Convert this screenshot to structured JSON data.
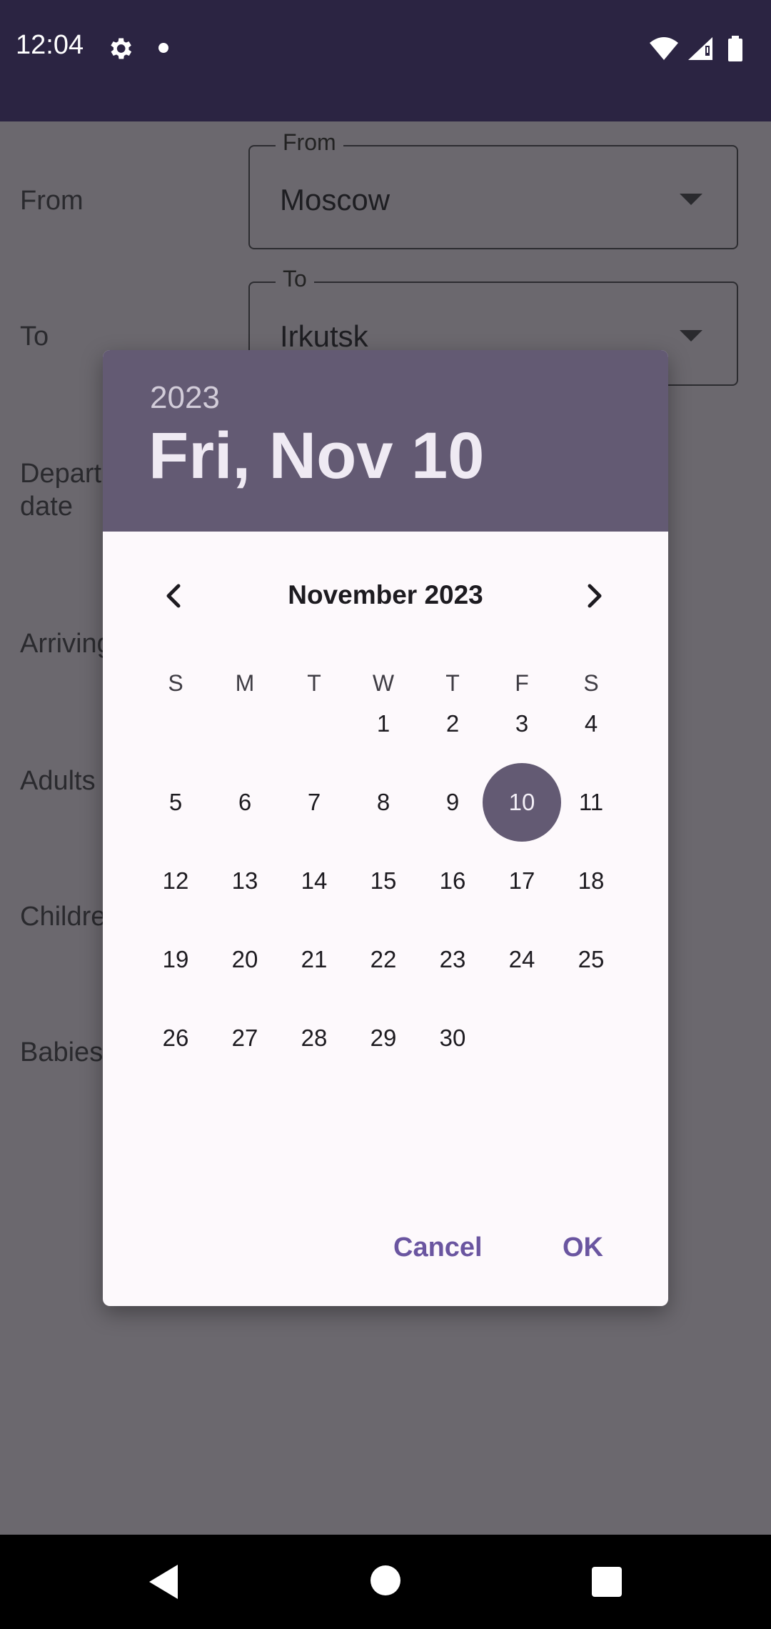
{
  "status_bar": {
    "time": "12:04"
  },
  "form": {
    "from_label": "From",
    "from_legend": "From",
    "from_value": "Moscow",
    "to_label": "To",
    "to_legend": "To",
    "to_value": "Irkutsk",
    "departure_label_line1": "Depart",
    "departure_label_line2": "date",
    "arriving_label": "Arriving",
    "adults_label": "Adults",
    "children_label": "Childre",
    "babies_label": "Babies"
  },
  "date_picker": {
    "year": "2023",
    "selected_date": "Fri, Nov 10",
    "month_title": "November 2023",
    "weekdays": [
      "S",
      "M",
      "T",
      "W",
      "T",
      "F",
      "S"
    ],
    "first_weekday_index": 3,
    "days_in_month": 30,
    "selected_day": 10,
    "cancel_label": "Cancel",
    "ok_label": "OK"
  },
  "colors": {
    "status_bar": "#2b2442",
    "header": "#635a73",
    "accent_button": "#6a55a0",
    "scrim": "#6b686e"
  }
}
